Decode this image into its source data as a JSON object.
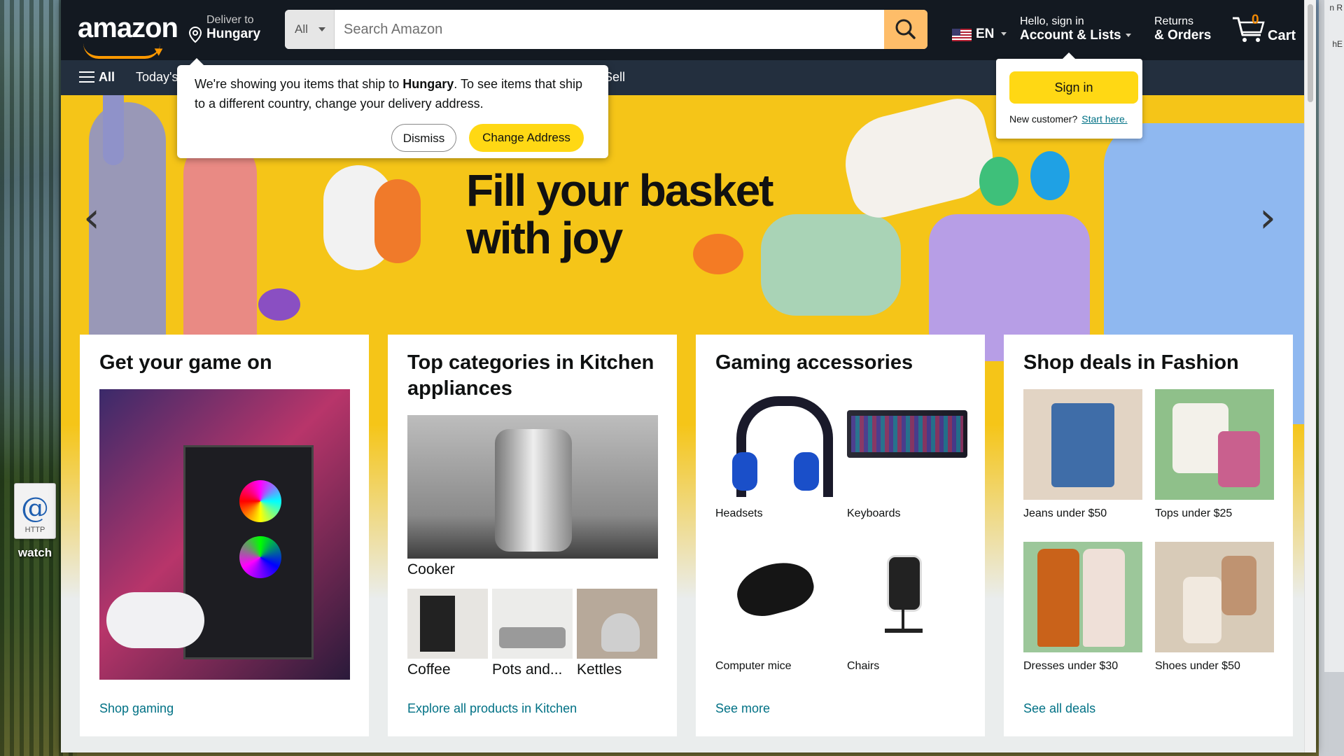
{
  "desktop": {
    "icon_label": "watch",
    "icon_badge": "HTTP",
    "icon_glyph": "@",
    "right_edge_text": [
      "n R",
      "hE"
    ]
  },
  "header": {
    "logo": "amazon",
    "deliver_line1": "Deliver to",
    "deliver_line2": "Hungary",
    "search_category": "All",
    "search_placeholder": "Search Amazon",
    "language": "EN",
    "account_line1": "Hello, sign in",
    "account_line2": "Account & Lists",
    "returns_line1": "Returns",
    "returns_line2": "& Orders",
    "cart_count": "0",
    "cart_label": "Cart"
  },
  "subnav": {
    "all_label": "All",
    "today_label": "Today's",
    "sell_label": "Sell"
  },
  "ship_popover": {
    "message_part1": "We're showing you items that ship to ",
    "message_country": "Hungary",
    "message_part2": ". To see items that ship to a different country, change your delivery address.",
    "dismiss_label": "Dismiss",
    "change_label": "Change Address"
  },
  "signin_popover": {
    "button_label": "Sign in",
    "new_customer": "New customer?",
    "start_here": "Start here."
  },
  "hero": {
    "title_line1": "Fill your basket",
    "title_line2": "with joy",
    "prev_glyph": "‹",
    "next_glyph": "›"
  },
  "cards": {
    "gaming": {
      "title": "Get your game on",
      "link": "Shop gaming"
    },
    "kitchen": {
      "title": "Top categories in Kitchen appliances",
      "main_label": "Cooker",
      "tiles": [
        "Coffee",
        "Pots and...",
        "Kettles"
      ],
      "link": "Explore all products in Kitchen"
    },
    "accessories": {
      "title": "Gaming accessories",
      "tiles": [
        "Headsets",
        "Keyboards",
        "Computer mice",
        "Chairs"
      ],
      "link": "See more"
    },
    "fashion": {
      "title": "Shop deals in Fashion",
      "tiles": [
        "Jeans under $50",
        "Tops under $25",
        "Dresses under $30",
        "Shoes under $50"
      ],
      "link": "See all deals"
    }
  },
  "colors": {
    "header_bg": "#131921",
    "subnav_bg": "#232f3e",
    "hero_bg": "#f5c518",
    "accent": "#ff9900",
    "button_yellow": "#ffd814",
    "link": "#007185"
  }
}
